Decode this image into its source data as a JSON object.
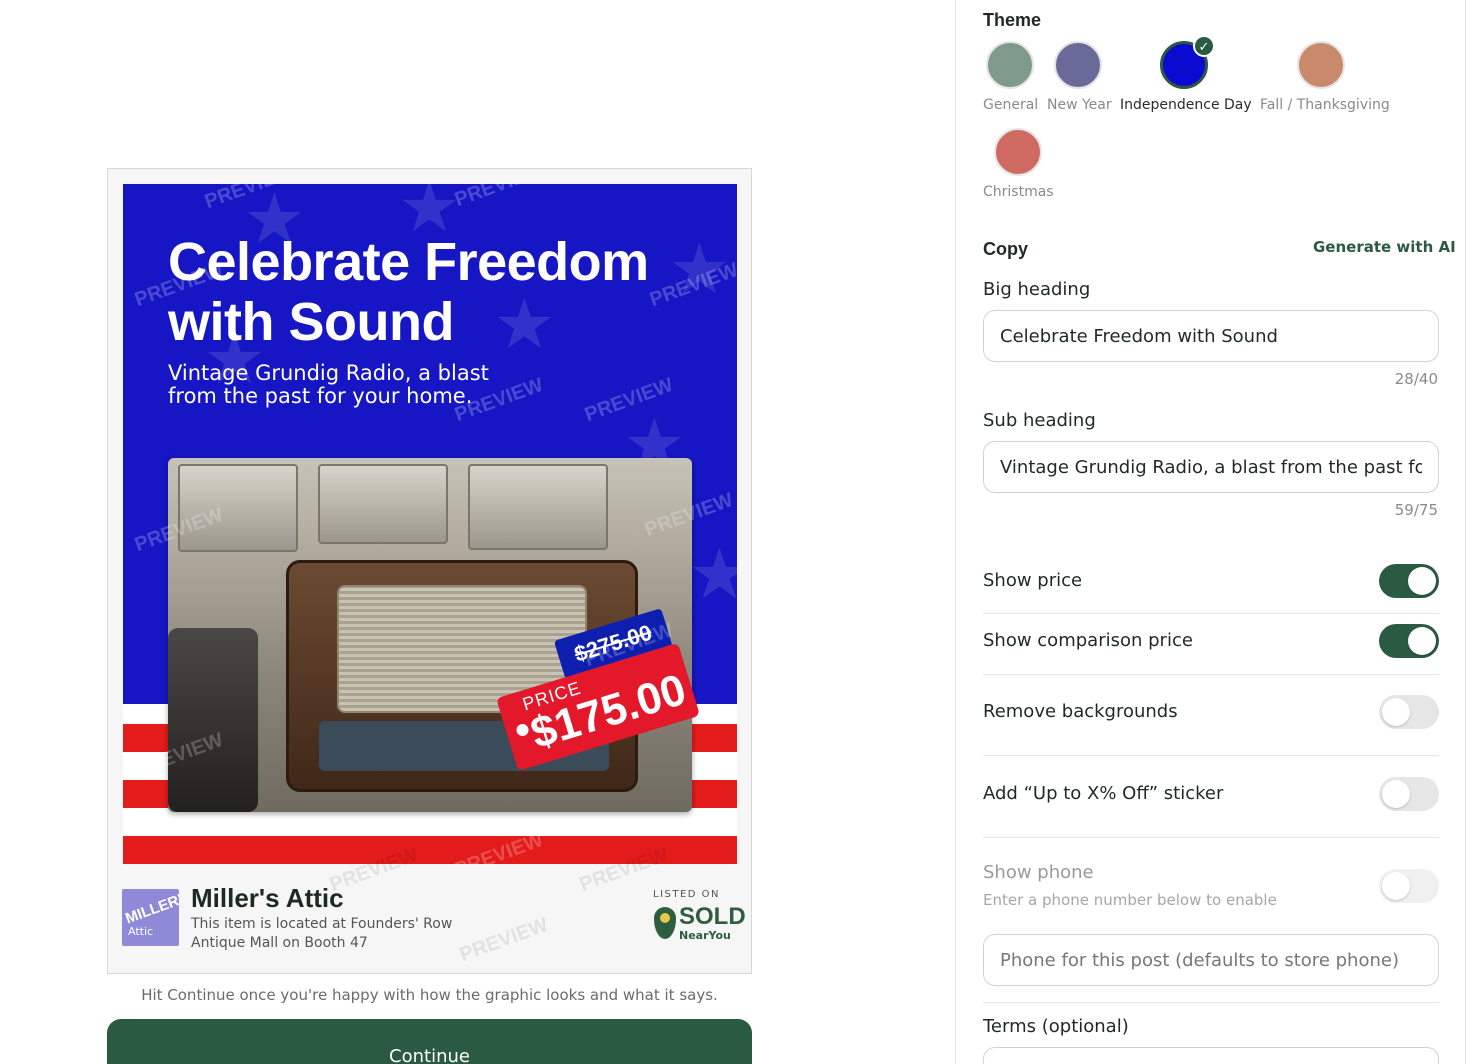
{
  "preview": {
    "heading": "Celebrate Freedom with Sound",
    "subheading": "Vintage Grundig Radio, a blast from the past for your home.",
    "price_label": "PRICE",
    "price": "$175.00",
    "comparison_price": "$275.00",
    "watermark": "PREVIEW",
    "store": {
      "logo_line1": "MILLER'S",
      "logo_line2": "Attic",
      "name": "Miller's Attic",
      "location": "This item is located at Founders' Row Antique Mall on Booth 47"
    },
    "listed_on": "LISTED ON",
    "brand_sold": "SOLD",
    "brand_nearyou": "NearYou",
    "colors": {
      "poster_blue": "#1616c4",
      "stripe_red": "#e31b1b",
      "tag_red": "#e3182a",
      "tag_blue": "#0e1fb0"
    }
  },
  "hint": "Hit Continue once you're happy with how the graphic looks and what it says.",
  "continue_label": "Continue",
  "panel": {
    "theme": {
      "title": "Theme",
      "options": [
        {
          "label": "General",
          "color": "#7f9a8a",
          "selected": false
        },
        {
          "label": "New Year",
          "color": "#6a6a9a",
          "selected": false
        },
        {
          "label": "Independence Day",
          "color": "#0a0ad0",
          "selected": true
        },
        {
          "label": "Fall / Thanksgiving",
          "color": "#c98a6c",
          "selected": false
        },
        {
          "label": "Christmas",
          "color": "#cf6a62",
          "selected": false
        }
      ],
      "check_icon": "✓"
    },
    "copy": {
      "title": "Copy",
      "generate_label": "Generate with AI",
      "big_heading_label": "Big heading",
      "big_heading_value": "Celebrate Freedom with Sound",
      "big_heading_count": "28/40",
      "sub_heading_label": "Sub heading",
      "sub_heading_value": "Vintage Grundig Radio, a blast from the past for your home.",
      "sub_heading_count": "59/75"
    },
    "toggles": {
      "show_price": {
        "label": "Show price",
        "on": true
      },
      "show_comparison": {
        "label": "Show comparison price",
        "on": true
      },
      "remove_backgrounds": {
        "label": "Remove backgrounds",
        "on": false
      },
      "sticker": {
        "label": "Add “Up to X% Off” sticker",
        "on": false
      },
      "show_phone": {
        "label": "Show phone",
        "help": "Enter a phone number below to enable",
        "on": false,
        "disabled": true
      }
    },
    "phone_placeholder": "Phone for this post (defaults to store phone)",
    "terms_label": "Terms (optional)"
  }
}
